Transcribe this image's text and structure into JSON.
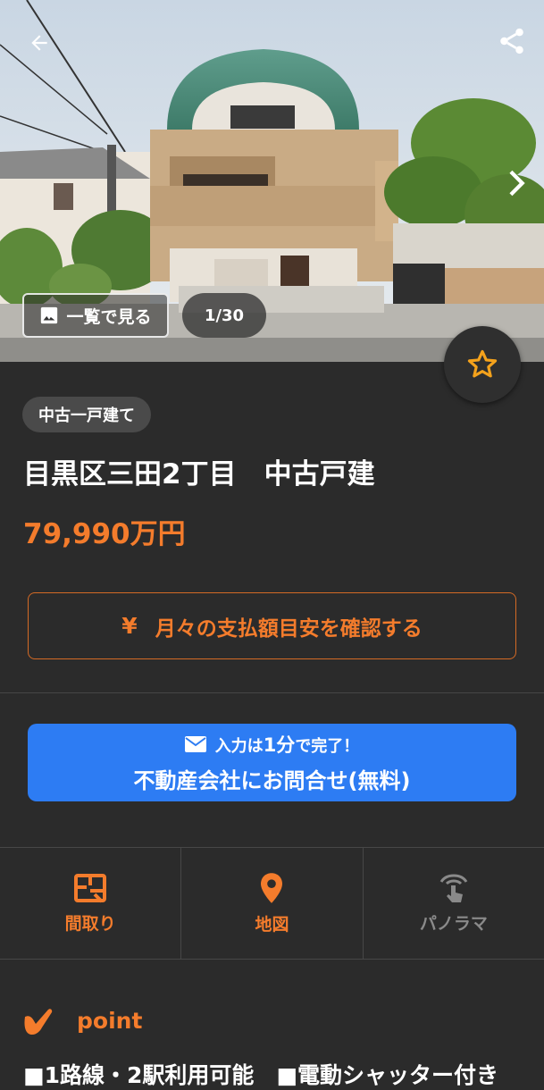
{
  "gallery": {
    "view_list_label": "一覧で見る",
    "counter": "1/30"
  },
  "property": {
    "type_chip": "中古一戸建て",
    "title": "目黒区三田2丁目　中古戸建",
    "price": "79,990万円"
  },
  "payment": {
    "yen_symbol": "¥",
    "label": "月々の支払額目安を確認する"
  },
  "contact": {
    "pre": "入力は",
    "emph": "1分",
    "post": "で完了！",
    "main": "不動産会社にお問合せ(無料)"
  },
  "tabs": [
    {
      "label": "間取り",
      "icon": "floorplan-icon"
    },
    {
      "label": "地図",
      "icon": "map-pin-icon"
    },
    {
      "label": "パノラマ",
      "icon": "panorama-icon"
    }
  ],
  "point": {
    "heading": "point",
    "text": "■1路線・2駅利用可能　■電動シャッター付き"
  },
  "colors": {
    "accent": "#f47c2c",
    "contact_blue": "#2d7cf3",
    "background": "#2b2b2b"
  }
}
